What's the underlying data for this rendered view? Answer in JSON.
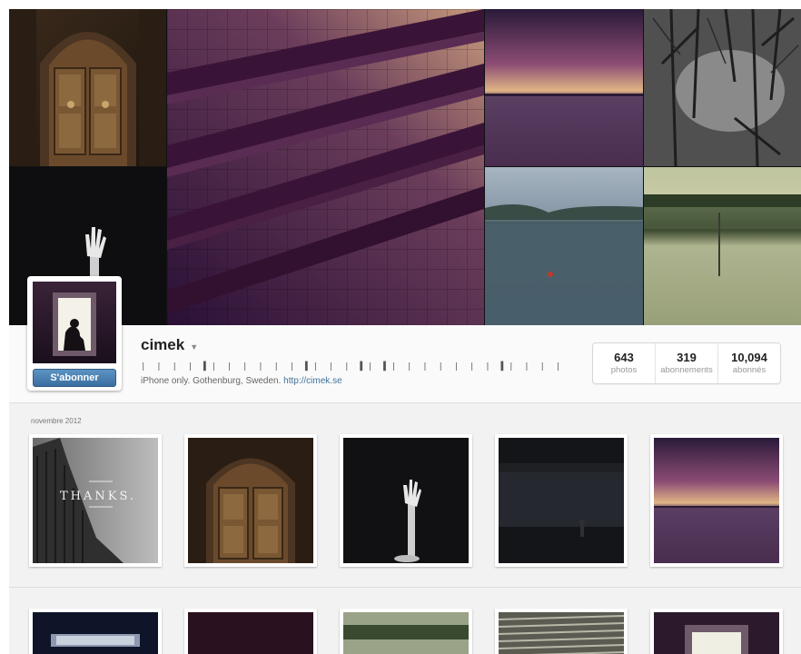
{
  "profile": {
    "username": "cimek",
    "bio_bars": "| | | | ▌| | | | | | ▌| | | ▌| ▌| | | | | | | ▌| | | |",
    "bio_text": "iPhone only. Gothenburg, Sweden.",
    "bio_link": "http://cimek.se",
    "follow_label": "S'abonner"
  },
  "stats": [
    {
      "value": "643",
      "label": "photos"
    },
    {
      "value": "319",
      "label": "abonnements"
    },
    {
      "value": "10,094",
      "label": "abonnés"
    }
  ],
  "feed": {
    "month_label": "novembre 2012",
    "first_photo_caption": "THANKS."
  },
  "icons": {
    "user_menu": "chevron-down-icon"
  }
}
